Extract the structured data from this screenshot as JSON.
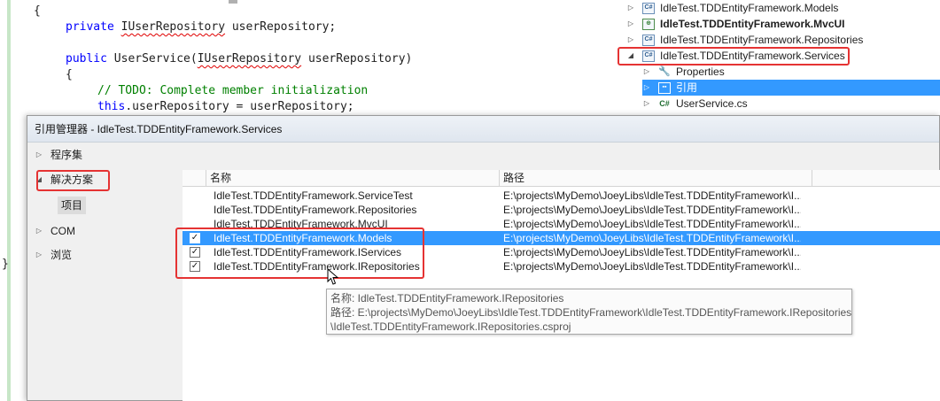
{
  "editor": {
    "line_brace_open": "{",
    "line_field_kw": "private",
    "line_field_type": "IUserRepository",
    "line_field_rest": " userRepository;",
    "line_ctor_kw": "public",
    "line_ctor_name": " UserService(",
    "line_ctor_type": "IUserRepository",
    "line_ctor_rest": " userRepository)",
    "line_ctor_brace": "{",
    "line_comment": "// TODO: Complete member initialization",
    "line_this_kw": "this",
    "line_this_rest": ".userRepository = userRepository;",
    "line_brace_close": "}"
  },
  "explorer": {
    "items": [
      {
        "label": "IdleTest.TDDEntityFramework.Models",
        "icon": "csharp-project-icon"
      },
      {
        "label": "IdleTest.TDDEntityFramework.MvcUI",
        "icon": "web-project-icon"
      },
      {
        "label": "IdleTest.TDDEntityFramework.Repositories",
        "icon": "csharp-project-icon"
      },
      {
        "label": "IdleTest.TDDEntityFramework.Services",
        "icon": "csharp-project-icon"
      },
      {
        "label": "Properties",
        "icon": "wrench-icon"
      },
      {
        "label": "引用",
        "icon": "references-icon"
      },
      {
        "label": "UserService.cs",
        "icon": "cs-file-icon"
      }
    ],
    "project_icon_text": "C#",
    "cs_icon_text": "C#"
  },
  "dialog": {
    "title": "引用管理器 - IdleTest.TDDEntityFramework.Services",
    "nav": {
      "assemblies": "程序集",
      "solution": "解决方案",
      "projects": "项目",
      "com": "COM",
      "browse": "浏览"
    },
    "columns": {
      "name": "名称",
      "path": "路径"
    },
    "rows": [
      {
        "name": "IdleTest.TDDEntityFramework.ServiceTest",
        "path": "E:\\projects\\MyDemo\\JoeyLibs\\IdleTest.TDDEntityFramework\\I...",
        "checked": false
      },
      {
        "name": "IdleTest.TDDEntityFramework.Repositories",
        "path": "E:\\projects\\MyDemo\\JoeyLibs\\IdleTest.TDDEntityFramework\\I...",
        "checked": false
      },
      {
        "name": "IdleTest.TDDEntityFramework.MvcUI",
        "path": "E:\\projects\\MyDemo\\JoeyLibs\\IdleTest.TDDEntityFramework\\I...",
        "checked": false
      },
      {
        "name": "IdleTest.TDDEntityFramework.Models",
        "path": "E:\\projects\\MyDemo\\JoeyLibs\\IdleTest.TDDEntityFramework\\I...",
        "checked": true
      },
      {
        "name": "IdleTest.TDDEntityFramework.IServices",
        "path": "E:\\projects\\MyDemo\\JoeyLibs\\IdleTest.TDDEntityFramework\\I...",
        "checked": true
      },
      {
        "name": "IdleTest.TDDEntityFramework.IRepositories",
        "path": "E:\\projects\\MyDemo\\JoeyLibs\\IdleTest.TDDEntityFramework\\I...",
        "checked": true
      }
    ],
    "check_glyph": "✓",
    "tooltip": {
      "line1": "名称: IdleTest.TDDEntityFramework.IRepositories",
      "line2": "路径: E:\\projects\\MyDemo\\JoeyLibs\\IdleTest.TDDEntityFramework\\IdleTest.TDDEntityFramework.IRepositories",
      "line3": "\\IdleTest.TDDEntityFramework.IRepositories.csproj"
    }
  },
  "colors": {
    "selection": "#3399ff",
    "annotation_red": "#e53333",
    "keyword": "#0000ff",
    "comment": "#008000"
  }
}
